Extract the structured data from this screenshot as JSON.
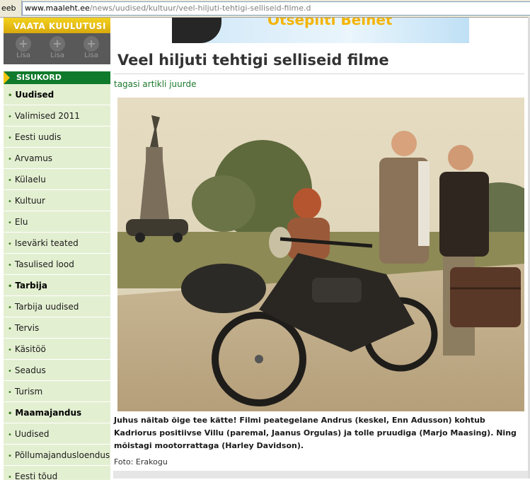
{
  "browser": {
    "address_label": "eeb",
    "url_domain": "www.maaleht.ee",
    "url_path": "/news/uudised/kultuur/veel-hiljuti-tehtigi-selliseid-filme.d"
  },
  "ad_box": {
    "title": "VAATA KUULUTUSI",
    "buttons": [
      "Lisa",
      "Lisa",
      "Lisa"
    ]
  },
  "banner": {
    "text": "Otsepilti Belnet"
  },
  "sidebar": {
    "header": "SISUKORD",
    "items": [
      {
        "label": "Uudised",
        "section": true
      },
      {
        "label": "Valimised 2011",
        "section": false
      },
      {
        "label": "Eesti uudis",
        "section": false
      },
      {
        "label": "Arvamus",
        "section": false
      },
      {
        "label": "Külaelu",
        "section": false
      },
      {
        "label": "Kultuur",
        "section": false
      },
      {
        "label": "Elu",
        "section": false
      },
      {
        "label": "Isevärki teated",
        "section": false
      },
      {
        "label": "Tasulised lood",
        "section": false
      },
      {
        "label": "Tarbija",
        "section": true
      },
      {
        "label": "Tarbija uudised",
        "section": false
      },
      {
        "label": "Tervis",
        "section": false
      },
      {
        "label": "Käsitöö",
        "section": false
      },
      {
        "label": "Seadus",
        "section": false
      },
      {
        "label": "Turism",
        "section": false
      },
      {
        "label": "Maamajandus",
        "section": true
      },
      {
        "label": "Uudised",
        "section": false
      },
      {
        "label": "Põllumajandusloendus",
        "section": false
      },
      {
        "label": "Eesti tõud",
        "section": false
      }
    ]
  },
  "article": {
    "title": "Veel hiljuti tehtigi selliseid filme",
    "back_link": "tagasi artikli juurde",
    "caption": "Juhus näitab õige tee kätte! Filmi peategelane Andrus (keskel, Enn Adusson) kohtub Kadriorus positiivse Villu (paremal, Jaanus Orgulas) ja tolle pruudiga (Marjo Maasing). Ning mõistagi mootorrattaga (Harley Davidson).",
    "photo_credit": "Foto: Erakogu"
  },
  "colors": {
    "nav_green": "#0f7a2b",
    "nav_bg": "#e3efd1",
    "accent_yellow": "#f2c40f",
    "link_green": "#1d7a2d"
  }
}
